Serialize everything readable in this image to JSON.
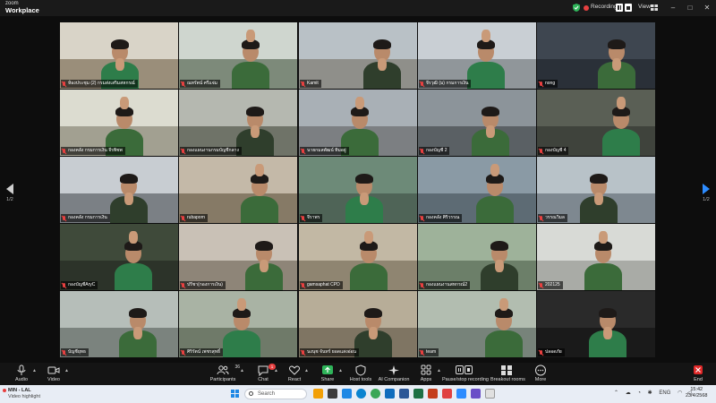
{
  "window": {
    "brand_small": "zoom",
    "brand_large": "Workplace",
    "recording_label": "Recording...",
    "view_label": "View",
    "win_min": "–",
    "win_max": "□",
    "win_close": "✕"
  },
  "pager": {
    "left_page": "1/2",
    "right_page": "1/2"
  },
  "participants": [
    {
      "name": "ห้องประชุม (2) กรมส่งเสริมสหกรณ์",
      "active": true
    },
    {
      "name": "ณทรัตน์ ศรีแจ่ม"
    },
    {
      "name": "Kamit"
    },
    {
      "name": "จีรวุฒิ (ม) กรมการเงิน"
    },
    {
      "name": "nong"
    },
    {
      "name": "กองคลัง กรมการเงิน จีรพิชพ"
    },
    {
      "name": "กองแผนงานกรมบัญชีกลาง"
    },
    {
      "name": "นายกมลพัฒน์ ทิมอยู่"
    },
    {
      "name": "กองบัญชี 2"
    },
    {
      "name": "กองบัญชี 4"
    },
    {
      "name": "กองคลัง กรมการเงิน"
    },
    {
      "name": "rubaporn"
    },
    {
      "name": "จีราพร"
    },
    {
      "name": "กองคลัง ศิริวรรณ"
    },
    {
      "name": "วรรณวิมล"
    },
    {
      "name": "กองบัญชีAryC"
    },
    {
      "name": "ปรีชา(กองการเงิน)"
    },
    {
      "name": "gamsaphat CPD"
    },
    {
      "name": "กองแผนงานสหกรณ์2"
    },
    {
      "name": "202125"
    },
    {
      "name": "บัญชียุทธ"
    },
    {
      "name": "ศิริรัตน์ เพชรสุทธิ์"
    },
    {
      "name": "นงนุช จันทร์ ยอดแสงอ่อน"
    },
    {
      "name": "team"
    },
    {
      "name": "ปลอดภัย"
    }
  ],
  "toolbar": {
    "audio": "Audio",
    "video": "Video",
    "participants": "Participants",
    "participants_count": "36",
    "chat": "Chat",
    "chat_badge": "1",
    "react": "React",
    "share": "Share",
    "host_tools": "Host tools",
    "ai_companion": "AI Companion",
    "apps": "Apps",
    "recording": "Pause/stop recording",
    "breakout": "Breakout rooms",
    "more": "More",
    "end": "End"
  },
  "taskbar": {
    "weather_title": "MIN - LAL",
    "weather_sub": "Video highlight",
    "search_placeholder": "Search",
    "lang": "ENG",
    "time": "15:42",
    "date": "23/4/2568"
  },
  "colors": {
    "active_speaker": "#3ec86d",
    "recording_dot": "#e84040",
    "pager_accent": "#2d8cff",
    "end_button": "#e02828",
    "share_icon": "#2fb55a"
  }
}
